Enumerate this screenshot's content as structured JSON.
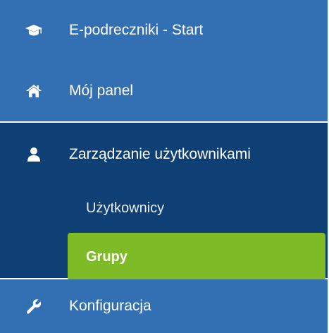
{
  "menu": {
    "items": [
      {
        "label": "E-podreczniki - Start",
        "icon": "graduation-cap-icon"
      },
      {
        "label": "Mój panel",
        "icon": "home-icon"
      }
    ],
    "active_section": {
      "label": "Zarządzanie użytkownikami",
      "icon": "user-icon",
      "children": [
        {
          "label": "Użytkownicy",
          "selected": false
        },
        {
          "label": "Grupy",
          "selected": true
        }
      ]
    },
    "after_items": [
      {
        "label": "Konfiguracja",
        "icon": "wrench-icon"
      }
    ]
  },
  "colors": {
    "nav_background": "#336fb3",
    "active_section_background": "#0e3f75",
    "selected_item_background": "#7fba27",
    "text": "#ffffff"
  }
}
